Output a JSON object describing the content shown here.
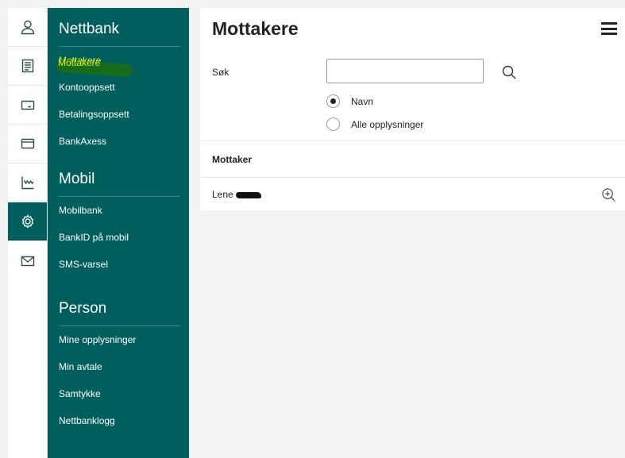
{
  "rail": {
    "items": [
      {
        "icon": "user-icon"
      },
      {
        "icon": "document-icon"
      },
      {
        "icon": "card-icon"
      },
      {
        "icon": "wallet-icon"
      },
      {
        "icon": "chart-icon"
      },
      {
        "icon": "gear-icon",
        "active": true
      },
      {
        "icon": "mail-icon"
      }
    ]
  },
  "menu": {
    "sections": [
      {
        "heading": "Nettbank",
        "items": [
          "Mottakere",
          "Kontooppsett",
          "Betalingsoppsett",
          "BankAxess"
        ]
      },
      {
        "heading": "Mobil",
        "items": [
          "Mobilbank",
          "BankID på mobil",
          "SMS-varsel"
        ]
      },
      {
        "heading": "Person",
        "items": [
          "Mine opplysninger",
          "Min avtale",
          "Samtykke",
          "Nettbanklogg"
        ]
      }
    ],
    "current": "Mottakere",
    "colors": {
      "background": "#005e5d",
      "current_item": "#d6f227",
      "highlight": "#1a6d10"
    }
  },
  "main": {
    "title": "Mottakere",
    "search": {
      "label": "Søk",
      "value": "",
      "placeholder": "",
      "options": [
        "Navn",
        "Alle opplysninger"
      ],
      "selected": "Navn"
    },
    "table": {
      "column_header": "Mottaker",
      "rows": [
        {
          "name": "Lene"
        }
      ]
    }
  }
}
